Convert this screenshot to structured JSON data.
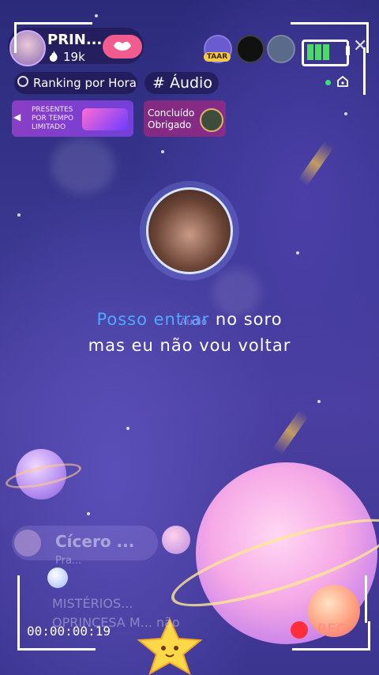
{
  "host": {
    "name": "PRIN...",
    "fans": "19k"
  },
  "viewers": {
    "rank_badge": "TAAR"
  },
  "toolbar": {
    "ranking_label": "Ranking por Hora",
    "tag_label": "# Áudio"
  },
  "banners": {
    "gift_text": "PRESENTES POR TEMPO LIMITADO",
    "thanks_text": "Concluído Obrigado"
  },
  "lyrics": {
    "line1_highlight": "Posso entrar",
    "line1_rest": " no soro",
    "line1_overlay": "Áudio",
    "line2": "mas eu não vou voltar"
  },
  "chat": {
    "name": "Cícero ...",
    "sub": "Pra...",
    "message": "MISTÉRIOS... OPRINCESA M... não"
  },
  "recorder": {
    "timecode": "00:00:00:19",
    "rec_label": "REC"
  },
  "colors": {
    "accent_pink": "#f15b8e",
    "lyric_highlight": "#4ea8ff",
    "rec_red": "#ff2e3a",
    "battery_green": "#4cd964"
  },
  "icons": [
    "flame-icon",
    "lips-icon",
    "clock-icon",
    "home-icon",
    "close-icon",
    "battery-icon"
  ]
}
